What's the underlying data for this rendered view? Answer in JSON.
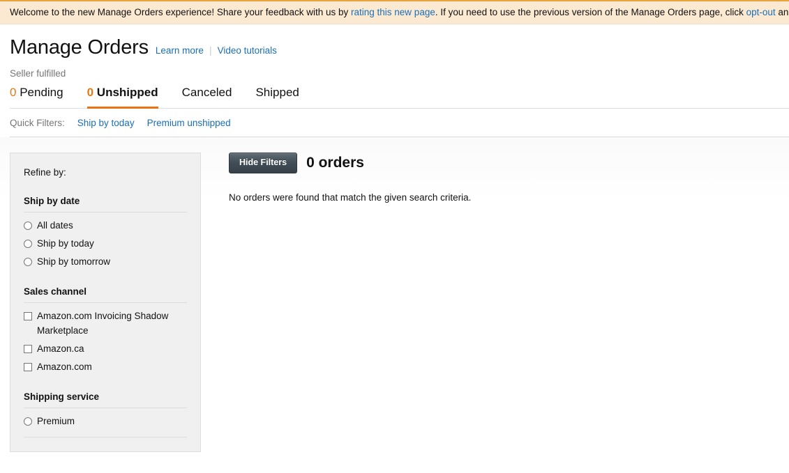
{
  "banner": {
    "text_1": "Welcome to the new Manage Orders experience! Share your feedback with us by ",
    "link_1": "rating this new page",
    "text_2": ". If you need to use the previous version of the Manage Orders page, click ",
    "link_2": "opt-out",
    "text_3": " and se",
    "bg_color": "#fce9d2",
    "border_color": "#e8a33d"
  },
  "header": {
    "title": "Manage Orders",
    "learn_more": "Learn more",
    "video_tutorials": "Video tutorials",
    "subtitle": "Seller fulfilled"
  },
  "tabs": [
    {
      "count": "0",
      "label": "Pending",
      "active": false
    },
    {
      "count": "0",
      "label": "Unshipped",
      "active": true
    },
    {
      "count": "",
      "label": "Canceled",
      "active": false
    },
    {
      "count": "",
      "label": "Shipped",
      "active": false
    }
  ],
  "quick_filters": {
    "label": "Quick Filters:",
    "items": [
      "Ship by today",
      "Premium unshipped"
    ]
  },
  "refine": {
    "heading": "Refine by:",
    "facets": [
      {
        "title": "Ship by date",
        "type": "radio",
        "options": [
          "All dates",
          "Ship by today",
          "Ship by tomorrow"
        ]
      },
      {
        "title": "Sales channel",
        "type": "checkbox",
        "options": [
          "Amazon.com Invoicing Shadow Marketplace",
          "Amazon.ca",
          "Amazon.com"
        ]
      },
      {
        "title": "Shipping service",
        "type": "radio",
        "options": [
          "Premium"
        ]
      }
    ]
  },
  "results": {
    "hide_filters_label": "Hide Filters",
    "orders_count": "0 orders",
    "empty_message": "No orders were found that match the given search criteria."
  },
  "colors": {
    "accent_orange": "#ec7211",
    "link_blue": "#1a6eb8",
    "panel_gray": "#f0f0f0",
    "button_dark": "#414d56"
  }
}
